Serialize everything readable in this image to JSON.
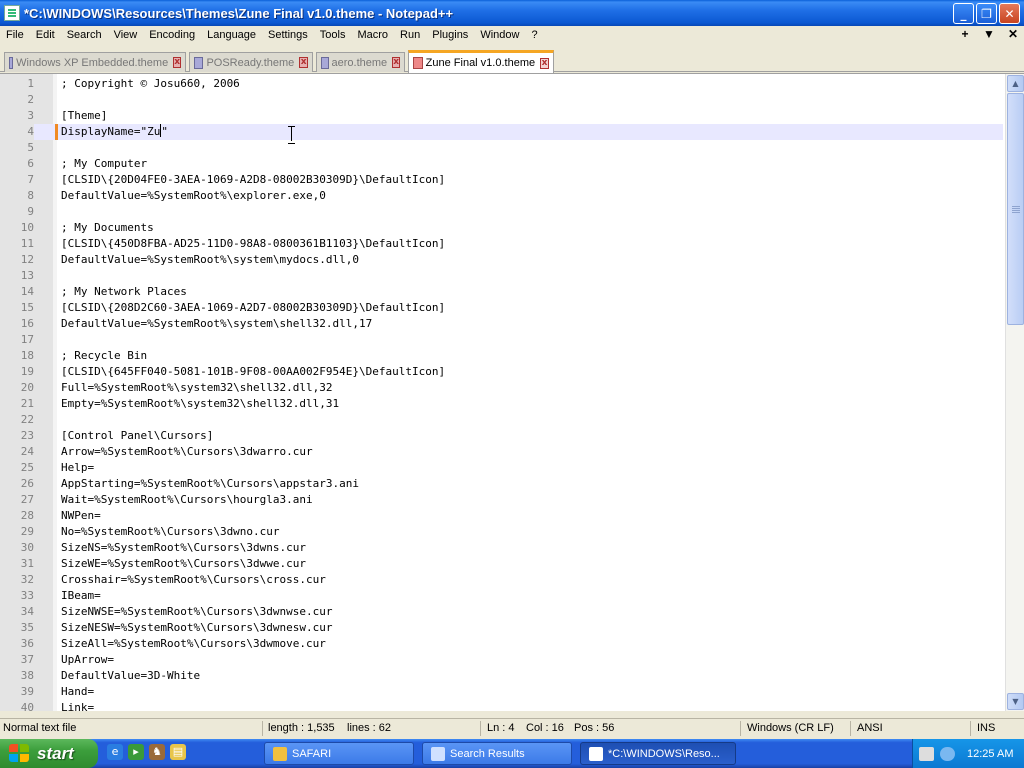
{
  "window": {
    "title": "*C:\\WINDOWS\\Resources\\Themes\\Zune Final v1.0.theme - Notepad++",
    "minimize": "_",
    "maximize": "❐",
    "close": "✕"
  },
  "menu": {
    "items": [
      "File",
      "Edit",
      "Search",
      "View",
      "Encoding",
      "Language",
      "Settings",
      "Tools",
      "Macro",
      "Run",
      "Plugins",
      "Window",
      "?"
    ],
    "right": [
      "+",
      "▼",
      "✕"
    ]
  },
  "tabs": [
    {
      "label": "Windows XP Embedded.theme",
      "active": false
    },
    {
      "label": "POSReady.theme",
      "active": false
    },
    {
      "label": "aero.theme",
      "active": false
    },
    {
      "label": "Zune Final v1.0.theme",
      "active": true
    }
  ],
  "editor": {
    "current_line": 4,
    "lines": [
      "; Copyright © Josu660, 2006",
      "",
      "[Theme]",
      "DisplayName=\"Zu\"",
      "",
      "; My Computer",
      "[CLSID\\{20D04FE0-3AEA-1069-A2D8-08002B30309D}\\DefaultIcon]",
      "DefaultValue=%SystemRoot%\\explorer.exe,0",
      "",
      "; My Documents",
      "[CLSID\\{450D8FBA-AD25-11D0-98A8-0800361B1103}\\DefaultIcon]",
      "DefaultValue=%SystemRoot%\\system\\mydocs.dll,0",
      "",
      "; My Network Places",
      "[CLSID\\{208D2C60-3AEA-1069-A2D7-08002B30309D}\\DefaultIcon]",
      "DefaultValue=%SystemRoot%\\system\\shell32.dll,17",
      "",
      "; Recycle Bin",
      "[CLSID\\{645FF040-5081-101B-9F08-00AA002F954E}\\DefaultIcon]",
      "Full=%SystemRoot%\\system32\\shell32.dll,32",
      "Empty=%SystemRoot%\\system32\\shell32.dll,31",
      "",
      "[Control Panel\\Cursors]",
      "Arrow=%SystemRoot%\\Cursors\\3dwarro.cur",
      "Help=",
      "AppStarting=%SystemRoot%\\Cursors\\appstar3.ani",
      "Wait=%SystemRoot%\\Cursors\\hourgla3.ani",
      "NWPen=",
      "No=%SystemRoot%\\Cursors\\3dwno.cur",
      "SizeNS=%SystemRoot%\\Cursors\\3dwns.cur",
      "SizeWE=%SystemRoot%\\Cursors\\3dwwe.cur",
      "Crosshair=%SystemRoot%\\Cursors\\cross.cur",
      "IBeam=",
      "SizeNWSE=%SystemRoot%\\Cursors\\3dwnwse.cur",
      "SizeNESW=%SystemRoot%\\Cursors\\3dwnesw.cur",
      "SizeAll=%SystemRoot%\\Cursors\\3dwmove.cur",
      "UpArrow=",
      "DefaultValue=3D-White",
      "Hand=",
      "Link="
    ]
  },
  "status": {
    "file_type": "Normal text file",
    "length": "length : 1,535",
    "lines": "lines : 62",
    "ln": "Ln : 4",
    "col": "Col : 16",
    "pos": "Pos : 56",
    "eol": "Windows (CR LF)",
    "encoding": "ANSI",
    "mode": "INS"
  },
  "taskbar": {
    "start": "start",
    "buttons": [
      {
        "label": "SAFARI",
        "active": false
      },
      {
        "label": "Search Results",
        "active": false
      },
      {
        "label": "*C:\\WINDOWS\\Reso...",
        "active": true
      }
    ],
    "clock": "12:25 AM"
  },
  "colors": {
    "titlebar": "#0b58d2",
    "current_line": "#e8e8ff",
    "change_marker": "#f08a24",
    "taskbar": "#245edb",
    "start": "#3c9e3c"
  }
}
